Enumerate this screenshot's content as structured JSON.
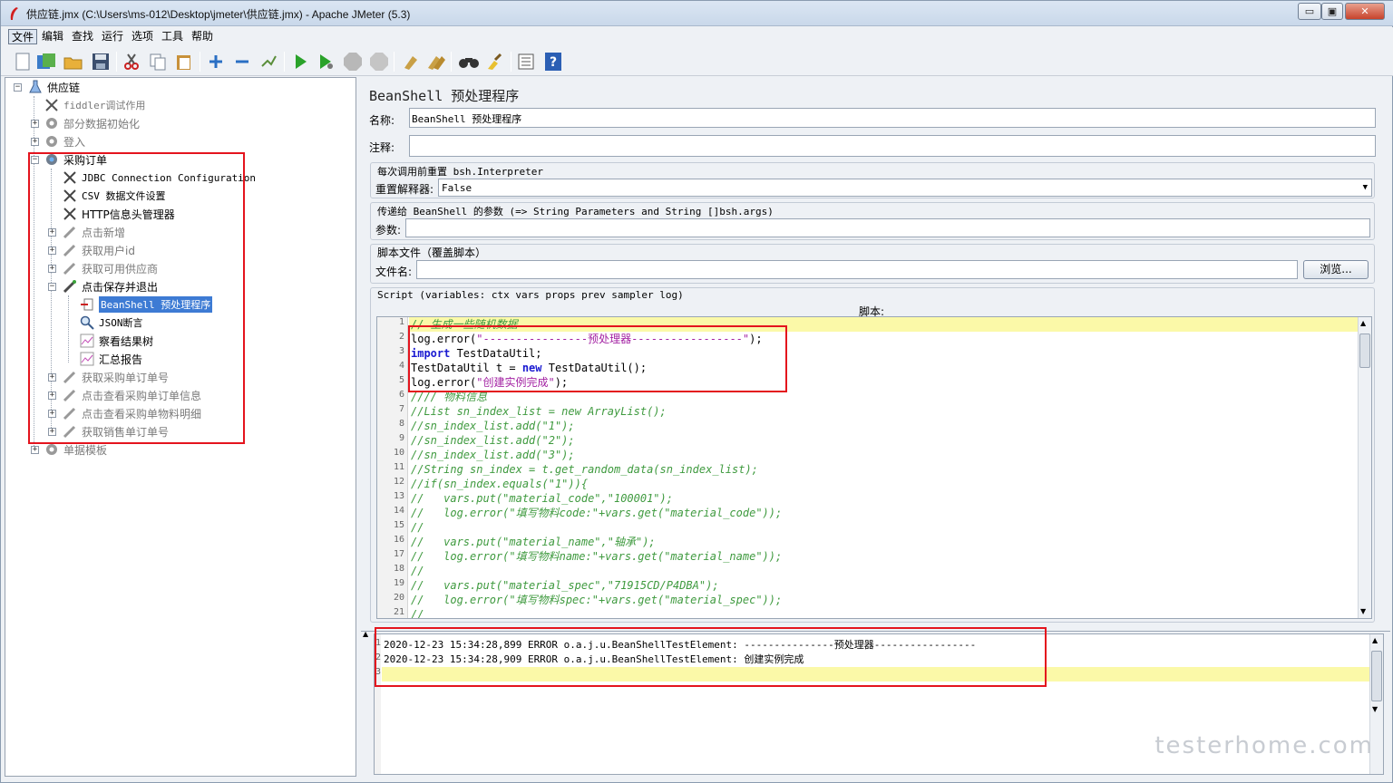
{
  "window": {
    "title": "供应链.jmx (C:\\Users\\ms-012\\Desktop\\jmeter\\供应链.jmx) - Apache JMeter (5.3)",
    "min_label": "▭",
    "max_label": "▣",
    "close_label": "✕"
  },
  "menu": [
    "文件",
    "编辑",
    "查找",
    "运行",
    "选项",
    "工具",
    "帮助"
  ],
  "tree": [
    {
      "label": "供应链",
      "style": "normal"
    },
    {
      "label": "fiddler调试作用",
      "style": "dis"
    },
    {
      "label": "部分数据初始化",
      "style": "dis"
    },
    {
      "label": "登入",
      "style": "dis"
    },
    {
      "label": "采购订单",
      "style": "normal"
    },
    {
      "label": "JDBC Connection Configuration",
      "style": "mono"
    },
    {
      "label": "CSV 数据文件设置",
      "style": "mono"
    },
    {
      "label": "HTTP信息头管理器",
      "style": "normal"
    },
    {
      "label": "点击新增",
      "style": "dis"
    },
    {
      "label": "获取用户id",
      "style": "dis"
    },
    {
      "label": "获取可用供应商",
      "style": "dis"
    },
    {
      "label": "点击保存并退出",
      "style": "normal"
    },
    {
      "label": "BeanShell 预处理程序",
      "style": "sel"
    },
    {
      "label": "JSON断言",
      "style": "normal"
    },
    {
      "label": "察看结果树",
      "style": "normal"
    },
    {
      "label": "汇总报告",
      "style": "normal"
    },
    {
      "label": "获取采购单订单号",
      "style": "dis"
    },
    {
      "label": "点击查看采购单订单信息",
      "style": "dis"
    },
    {
      "label": "点击查看采购单物料明细",
      "style": "dis"
    },
    {
      "label": "获取销售单订单号",
      "style": "dis"
    },
    {
      "label": "单据模板",
      "style": "dis"
    }
  ],
  "panel": {
    "title": "BeanShell 预处理程序",
    "name_label": "名称:",
    "name_value": "BeanShell 预处理程序",
    "comment_label": "注释:",
    "comment_value": "",
    "reset_group_title": "每次调用前重置 bsh.Interpreter",
    "reset_label": "重置解释器:",
    "reset_value": "False",
    "params_group_title": "传递给 BeanShell 的参数 (=> String Parameters and String []bsh.args)",
    "params_label": "参数:",
    "params_value": "",
    "script_file_group_title": "脚本文件（覆盖脚本）",
    "filename_label": "文件名:",
    "filename_value": "",
    "browse_label": "浏览...",
    "script_group_title": "Script (variables: ctx vars props prev sampler log)",
    "script_header": "脚本:"
  },
  "code": [
    {
      "n": "1",
      "t": "// 生成一些随机数据",
      "c": "cmt"
    },
    {
      "n": "2",
      "t": "log.error(\"----------------预处理器-----------------\");",
      "c": "mixed_str"
    },
    {
      "n": "3",
      "t": "import TestDataUtil;",
      "c": "import"
    },
    {
      "n": "4",
      "t": "TestDataUtil t = new TestDataUtil();",
      "c": "new"
    },
    {
      "n": "5",
      "t": "log.error(\"创建实例完成\");",
      "c": "mixed_str"
    },
    {
      "n": "6",
      "t": "//// 物料信息",
      "c": "cmt"
    },
    {
      "n": "7",
      "t": "//List sn_index_list = new ArrayList();",
      "c": "cmt"
    },
    {
      "n": "8",
      "t": "//sn_index_list.add(\"1\");",
      "c": "cmt"
    },
    {
      "n": "9",
      "t": "//sn_index_list.add(\"2\");",
      "c": "cmt"
    },
    {
      "n": "10",
      "t": "//sn_index_list.add(\"3\");",
      "c": "cmt"
    },
    {
      "n": "11",
      "t": "//String sn_index = t.get_random_data(sn_index_list);",
      "c": "cmt"
    },
    {
      "n": "12",
      "t": "//if(sn_index.equals(\"1\")){",
      "c": "cmt"
    },
    {
      "n": "13",
      "t": "//   vars.put(\"material_code\",\"100001\");",
      "c": "cmt"
    },
    {
      "n": "14",
      "t": "//   log.error(\"填写物料code:\"+vars.get(\"material_code\"));",
      "c": "cmt"
    },
    {
      "n": "15",
      "t": "//",
      "c": "cmt"
    },
    {
      "n": "16",
      "t": "//   vars.put(\"material_name\",\"轴承\");",
      "c": "cmt"
    },
    {
      "n": "17",
      "t": "//   log.error(\"填写物料name:\"+vars.get(\"material_name\"));",
      "c": "cmt"
    },
    {
      "n": "18",
      "t": "//",
      "c": "cmt"
    },
    {
      "n": "19",
      "t": "//   vars.put(\"material_spec\",\"71915CD/P4DBA\");",
      "c": "cmt"
    },
    {
      "n": "20",
      "t": "//   log.error(\"填写物料spec:\"+vars.get(\"material_spec\"));",
      "c": "cmt"
    },
    {
      "n": "21",
      "t": "//",
      "c": "cmt"
    }
  ],
  "log": [
    {
      "n": "1",
      "t": "2020-12-23 15:34:28,899 ERROR o.a.j.u.BeanShellTestElement: ---------------预处理器-----------------"
    },
    {
      "n": "2",
      "t": "2020-12-23 15:34:28,909 ERROR o.a.j.u.BeanShellTestElement: 创建实例完成"
    },
    {
      "n": "3",
      "t": ""
    }
  ],
  "watermark": "testerhome.com",
  "colors": {
    "accent": "#3d7bd4",
    "highlight": "#fbf9a8",
    "annotation": "#e4141d"
  }
}
